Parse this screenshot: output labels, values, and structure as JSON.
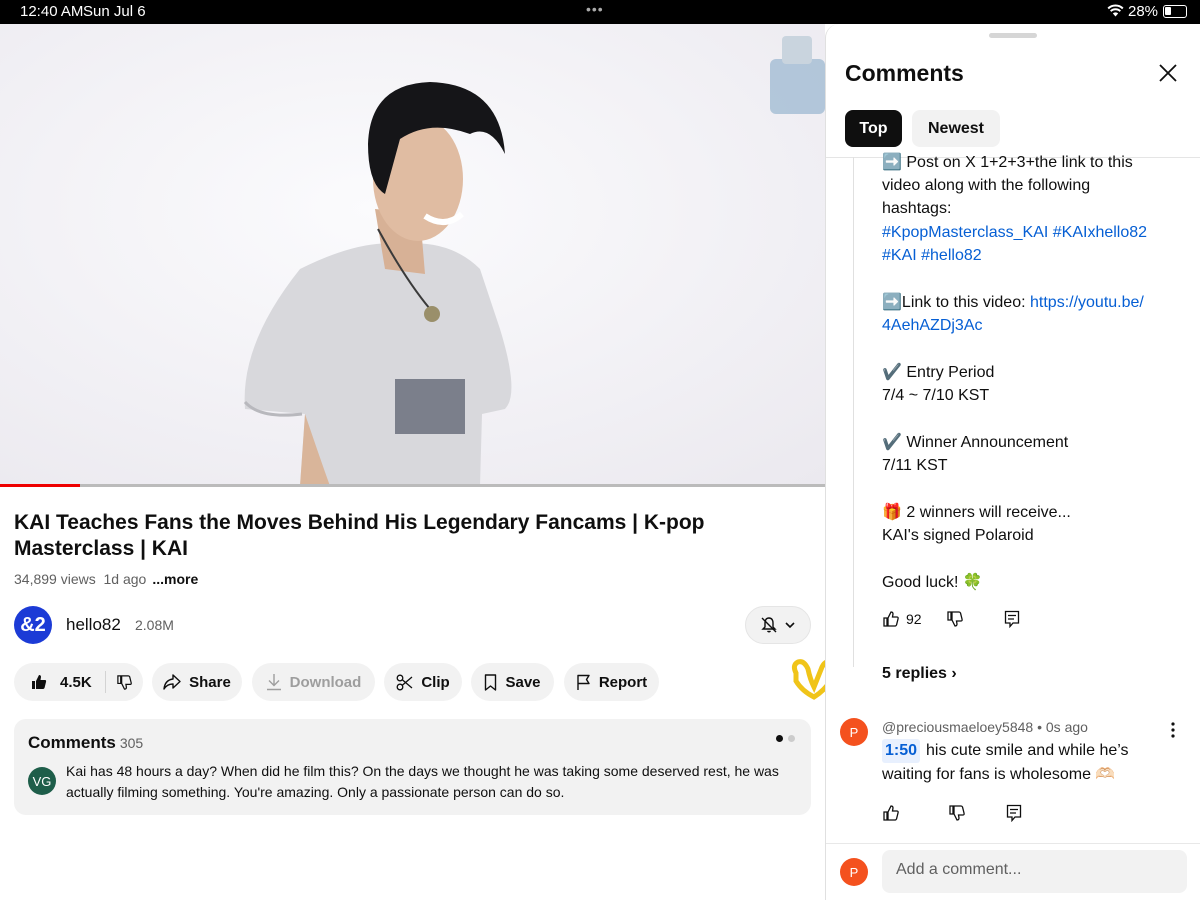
{
  "status_bar": {
    "time": "12:40 AM",
    "date": "Sun Jul 6",
    "battery": "28%",
    "battery_level": 0.28
  },
  "video": {
    "progress_played": 0.097,
    "progress_buffered_start": 0.121,
    "title": "KAI Teaches Fans the Moves Behind His Legendary Fancams | K-pop Masterclass | KAI",
    "views": "34,899 views",
    "age": "1d ago",
    "more_label": "...more"
  },
  "channel": {
    "avatar_text": "&2",
    "name": "hello82",
    "subscribers": "2.08M"
  },
  "actions": {
    "like_count": "4.5K",
    "share": "Share",
    "download": "Download",
    "clip": "Clip",
    "save": "Save",
    "report": "Report"
  },
  "comments_preview": {
    "heading": "Comments",
    "count": "305",
    "avatar": "VG",
    "text": "Kai has 48 hours a day? When did he film this? On the days we thought he was taking some deserved rest, he was actually filming something. You're amazing. Only a passionate person can do so."
  },
  "panel": {
    "title": "Comments",
    "tabs": [
      "Top",
      "Newest"
    ],
    "pinned_comment": {
      "lines": [
        {
          "text": "➡️ Post on X 1+2+3+the link to this"
        },
        {
          "text": "video along with the following"
        },
        {
          "text": "hashtags:"
        },
        {
          "text": "#KpopMasterclass_KAI #KAIxhello82",
          "link": true
        },
        {
          "text": "#KAI #hello82",
          "link": true
        },
        {
          "prefix": "➡️Link to this video: ",
          "text": "https://youtu.be/",
          "link": true
        },
        {
          "text": "4AehAZDj3Ac",
          "link": true
        },
        {
          "text": "✔️ Entry Period"
        },
        {
          "text": " 7/4 ~ 7/10 KST"
        },
        {
          "text": "✔️ Winner Announcement"
        },
        {
          "text": " 7/11 KST"
        },
        {
          "text": "🎁 2 winners will receive..."
        },
        {
          "text": "KAI's signed Polaroid"
        },
        {
          "text": "Good luck! 🍀"
        }
      ],
      "likes": "92",
      "replies_label": "5 replies"
    },
    "reply": {
      "avatar": "P",
      "handle": "@preciousmaeloey5848",
      "age": "0s ago",
      "timestamp": "1:50",
      "text": "his cute smile and while he’s waiting for fans is wholesome 🫶🏻"
    },
    "composer": {
      "avatar": "P",
      "placeholder": "Add a comment..."
    }
  }
}
